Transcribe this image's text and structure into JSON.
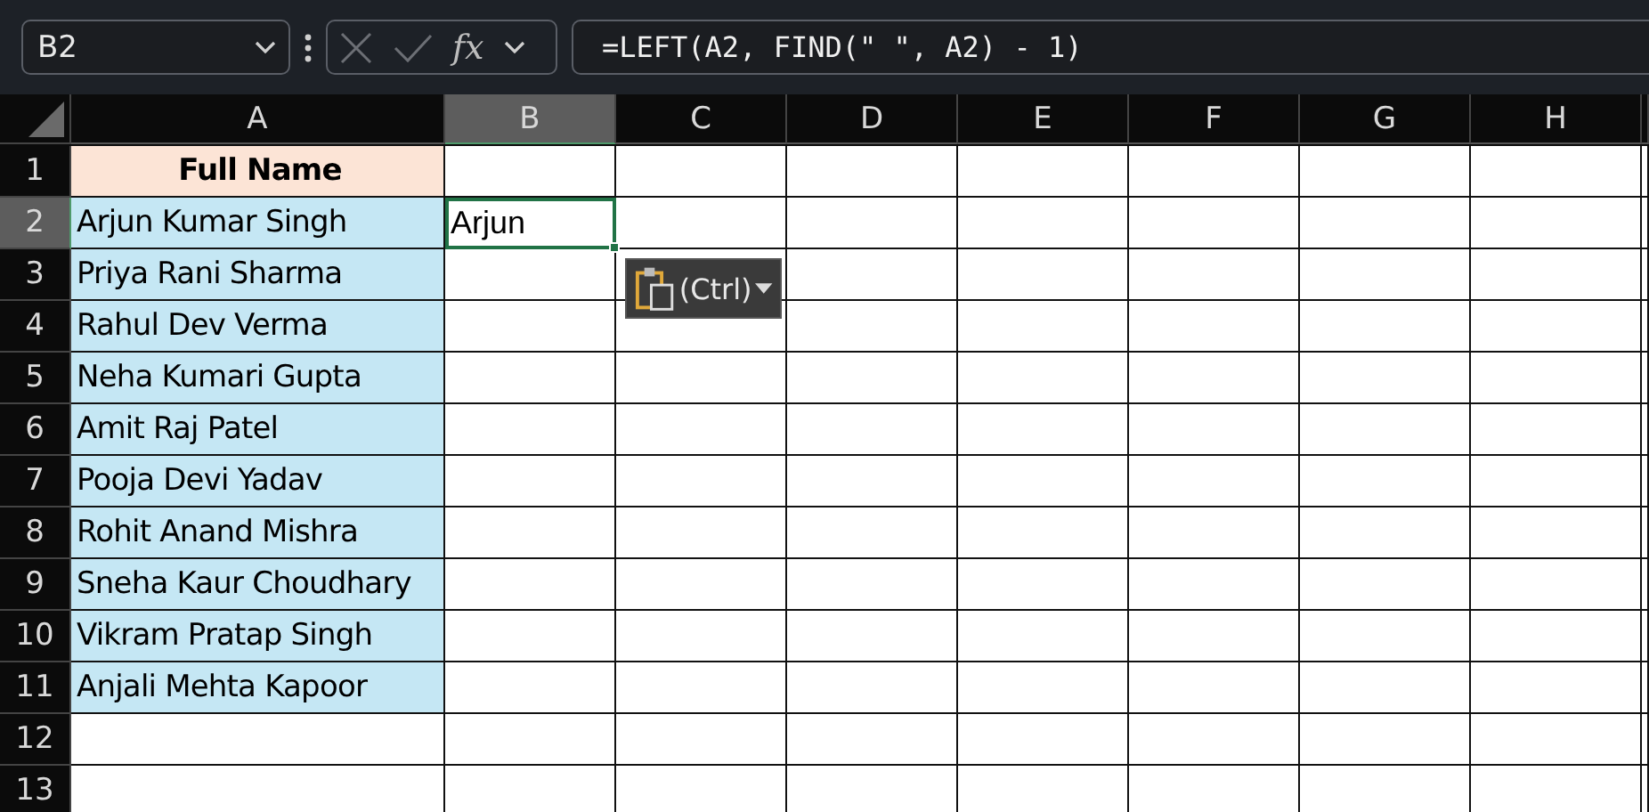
{
  "formula_bar": {
    "name_box": "B2",
    "function_label": "fx",
    "formula": "=LEFT(A2, FIND(\" \", A2) - 1)"
  },
  "columns": [
    {
      "label": "A",
      "selected": false
    },
    {
      "label": "B",
      "selected": true
    },
    {
      "label": "C",
      "selected": false
    },
    {
      "label": "D",
      "selected": false
    },
    {
      "label": "E",
      "selected": false
    },
    {
      "label": "F",
      "selected": false
    },
    {
      "label": "G",
      "selected": false
    },
    {
      "label": "H",
      "selected": false
    }
  ],
  "rows": [
    {
      "label": "1",
      "selected": false,
      "cells": [
        {
          "kind": "header",
          "text": "Full Name"
        }
      ]
    },
    {
      "label": "2",
      "selected": true,
      "cells": [
        {
          "kind": "name",
          "text": "Arjun Kumar Singh"
        },
        {
          "kind": "value",
          "text": "Arjun",
          "selected": true
        }
      ]
    },
    {
      "label": "3",
      "selected": false,
      "cells": [
        {
          "kind": "name",
          "text": "Priya Rani Sharma"
        }
      ]
    },
    {
      "label": "4",
      "selected": false,
      "cells": [
        {
          "kind": "name",
          "text": "Rahul Dev Verma"
        }
      ]
    },
    {
      "label": "5",
      "selected": false,
      "cells": [
        {
          "kind": "name",
          "text": "Neha Kumari Gupta"
        }
      ]
    },
    {
      "label": "6",
      "selected": false,
      "cells": [
        {
          "kind": "name",
          "text": "Amit Raj Patel"
        }
      ]
    },
    {
      "label": "7",
      "selected": false,
      "cells": [
        {
          "kind": "name",
          "text": "Pooja Devi Yadav"
        }
      ]
    },
    {
      "label": "8",
      "selected": false,
      "cells": [
        {
          "kind": "name",
          "text": "Rohit Anand Mishra"
        }
      ]
    },
    {
      "label": "9",
      "selected": false,
      "cells": [
        {
          "kind": "name",
          "text": "Sneha Kaur Choudhary"
        }
      ]
    },
    {
      "label": "10",
      "selected": false,
      "cells": [
        {
          "kind": "name",
          "text": "Vikram Pratap Singh"
        }
      ]
    },
    {
      "label": "11",
      "selected": false,
      "cells": [
        {
          "kind": "name",
          "text": "Anjali Mehta Kapoor"
        }
      ]
    },
    {
      "label": "12",
      "selected": false,
      "cells": []
    },
    {
      "label": "13",
      "selected": false,
      "cells": []
    }
  ],
  "paste_options": {
    "label": "(Ctrl)"
  }
}
